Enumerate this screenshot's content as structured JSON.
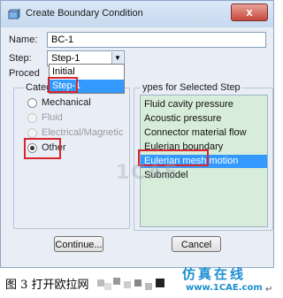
{
  "dialog": {
    "title": "Create Boundary Condition",
    "close_symbol": "x",
    "name_label": "Name:",
    "name_value": "BC-1",
    "step_label": "Step:",
    "step_value": "Step-1",
    "procedure_label": "Proced",
    "step_options": [
      "Initial",
      "Step-1"
    ],
    "category_label": "Categ",
    "categories": [
      {
        "label": "Mechanical",
        "state": "enabled"
      },
      {
        "label": "Fluid",
        "state": "disabled"
      },
      {
        "label": "Electrical/Magnetic",
        "state": "disabled"
      },
      {
        "label": "Other",
        "state": "checked"
      }
    ],
    "types_label": "ypes for Selected Step",
    "types": [
      "Fluid cavity pressure",
      "Acoustic pressure",
      "Connector material flow",
      "Eulerian boundary",
      "Eulerian mesh motion",
      "Submodel"
    ],
    "selected_type": "Eulerian mesh motion",
    "continue_label": "Continue...",
    "cancel_label": "Cancel"
  },
  "caption": {
    "text": "图 3  打开欧拉网"
  },
  "brand": {
    "name": "仿真在线",
    "url": "www.1CAE.com",
    "mark": "↵"
  },
  "colors": {
    "highlight": "#3399ff",
    "annotation_red": "#d9262c",
    "list_background": "#d7ecd9",
    "brand_blue": "#1c8fd0"
  }
}
